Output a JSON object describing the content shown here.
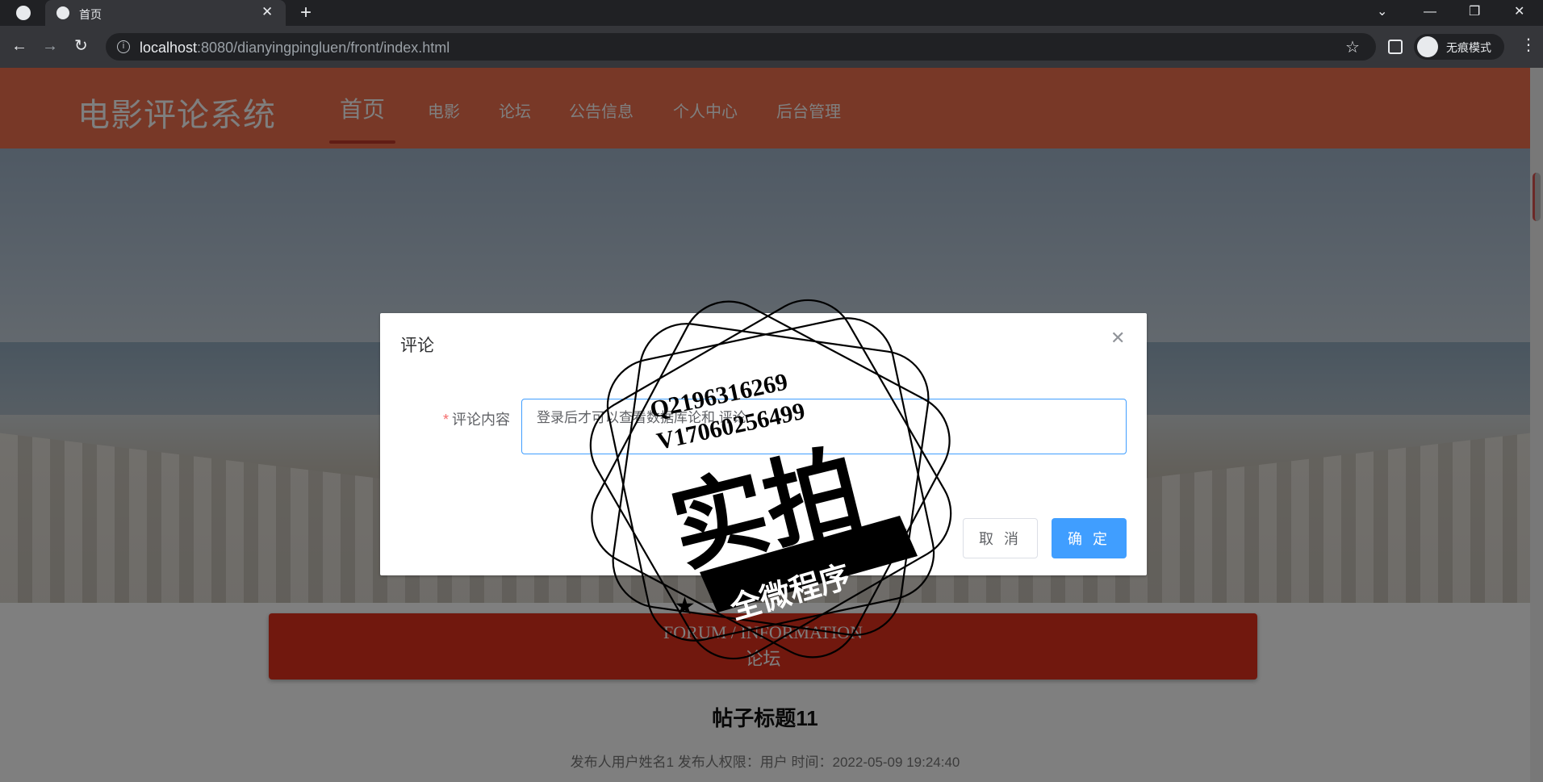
{
  "browser": {
    "tab_title": "首页",
    "url_host": "localhost",
    "url_path": ":8080/dianyingpingluen/front/index.html",
    "incognito_label": "无痕模式"
  },
  "site": {
    "title": "电影评论系统",
    "nav": [
      "首页",
      "电影",
      "论坛",
      "公告信息",
      "个人中心",
      "后台管理"
    ],
    "active_nav": "首页",
    "accent_color": "#f0704f"
  },
  "section": {
    "title_en": "FORUM / INFORMATION",
    "title_cn": "论坛"
  },
  "post": {
    "title": "帖子标题11",
    "meta": "发布人用户姓名1   发布人权限：用户   时间：2022-05-09 19:24:40"
  },
  "dialog": {
    "title": "评论",
    "field_label": "评论内容",
    "field_value": "登录后才可以查看数据库论和 评论",
    "cancel_label": "取 消",
    "confirm_label": "确 定",
    "primary_color": "#409eff"
  },
  "watermark": {
    "line1": "Q2196316269",
    "line2": "V17060256499",
    "big_text": "实拍",
    "ribbon_text": "全微程序"
  }
}
